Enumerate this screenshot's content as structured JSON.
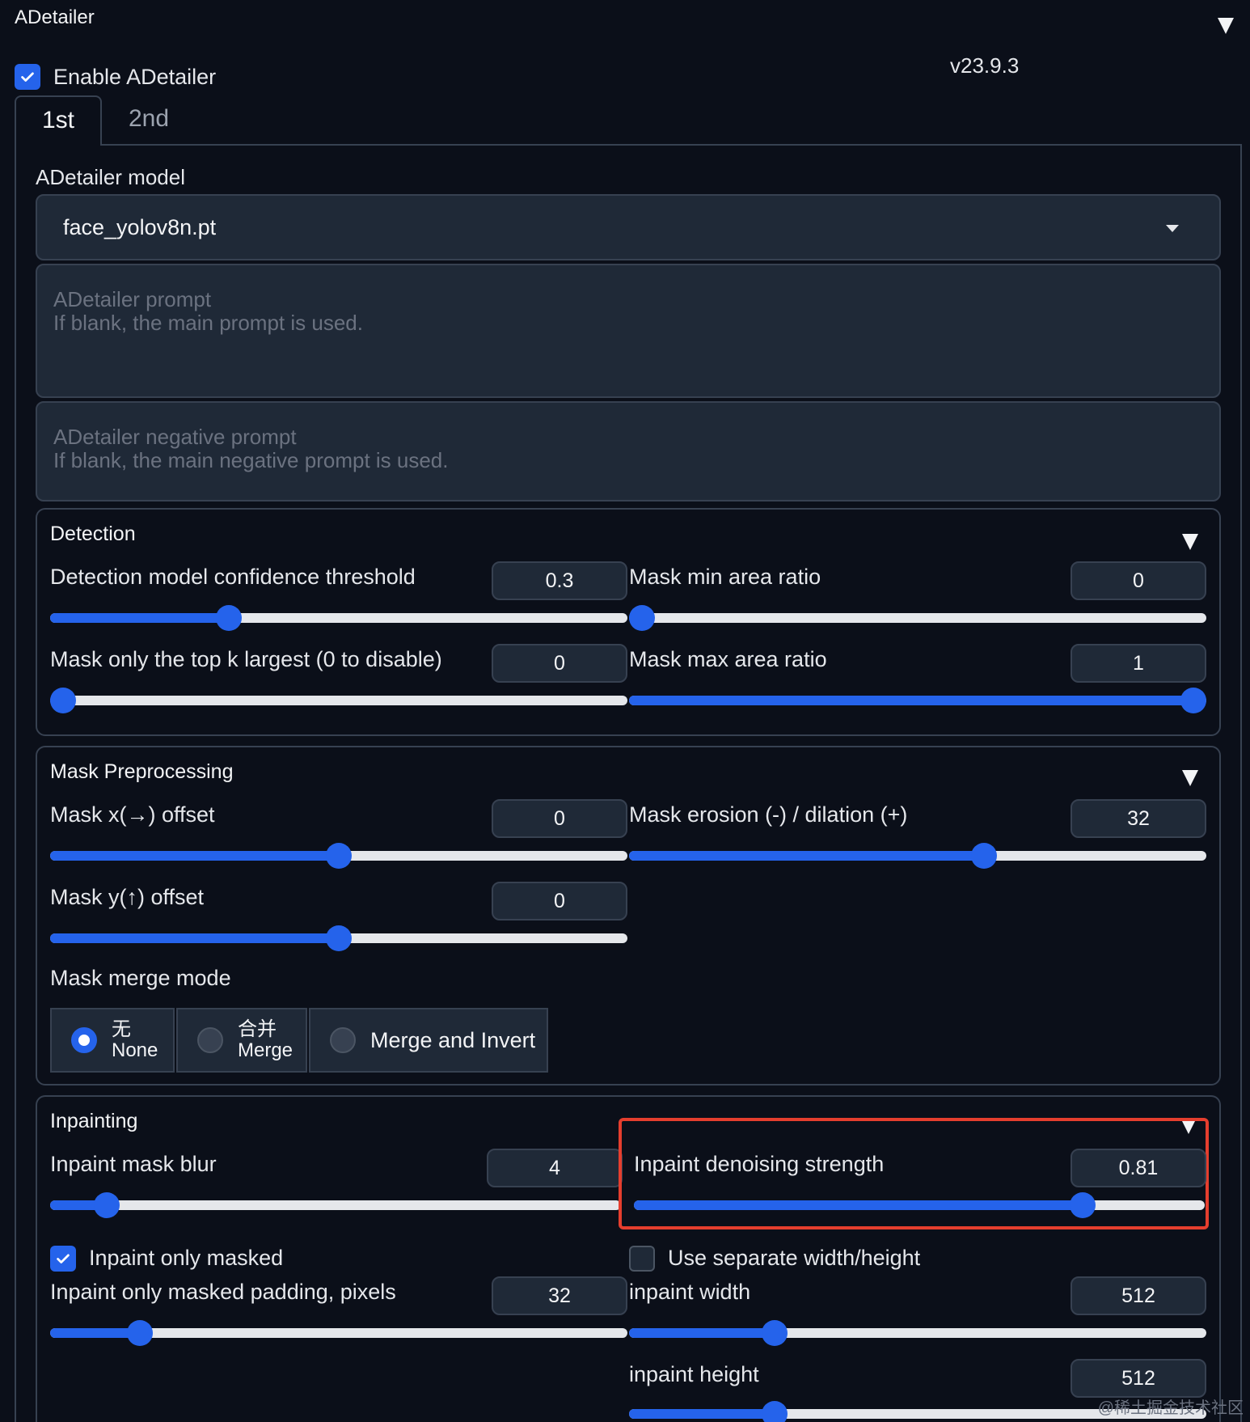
{
  "header": {
    "title": "ADetailer",
    "version": "v23.9.3"
  },
  "enable": {
    "label": "Enable ADetailer",
    "checked": true
  },
  "tabs": [
    {
      "label": "1st",
      "active": true
    },
    {
      "label": "2nd",
      "active": false
    }
  ],
  "model": {
    "label": "ADetailer model",
    "value": "face_yolov8n.pt"
  },
  "prompt": {
    "placeholder": "ADetailer prompt\nIf blank, the main prompt is used."
  },
  "negative_prompt": {
    "placeholder": "ADetailer negative prompt\nIf blank, the main negative prompt is used."
  },
  "detection": {
    "title": "Detection",
    "confidence": {
      "label": "Detection model confidence threshold",
      "value": "0.3",
      "fraction": 0.3
    },
    "min_area": {
      "label": "Mask min area ratio",
      "value": "0",
      "fraction": 0.0
    },
    "top_k": {
      "label": "Mask only the top k largest (0 to disable)",
      "value": "0",
      "fraction": 0.0
    },
    "max_area": {
      "label": "Mask max area ratio",
      "value": "1",
      "fraction": 1.0
    }
  },
  "mask_preprocessing": {
    "title": "Mask Preprocessing",
    "x_offset": {
      "label": "Mask x(→) offset",
      "value": "0",
      "fraction": 0.5
    },
    "erosion": {
      "label": "Mask erosion (-) / dilation (+)",
      "value": "32",
      "fraction": 0.62
    },
    "y_offset": {
      "label": "Mask y(↑) offset",
      "value": "0",
      "fraction": 0.5
    },
    "merge_mode": {
      "label": "Mask merge mode",
      "options": [
        {
          "zh": "无",
          "en": "None",
          "selected": true
        },
        {
          "zh": "合并",
          "en": "Merge",
          "selected": false
        },
        {
          "zh": "",
          "en": "Merge and Invert",
          "selected": false
        }
      ]
    }
  },
  "inpainting": {
    "title": "Inpainting",
    "mask_blur": {
      "label": "Inpaint mask blur",
      "value": "4",
      "fraction": 0.08
    },
    "denoising": {
      "label": "Inpaint denoising strength",
      "value": "0.81",
      "fraction": 0.8
    },
    "only_masked": {
      "label": "Inpaint only masked",
      "checked": true
    },
    "separate_wh": {
      "label": "Use separate width/height",
      "checked": false
    },
    "padding": {
      "label": "Inpaint only masked padding, pixels",
      "value": "32",
      "fraction": 0.14
    },
    "width": {
      "label": "inpaint width",
      "value": "512",
      "fraction": 0.24
    },
    "height": {
      "label": "inpaint height",
      "value": "512",
      "fraction": 0.24
    }
  },
  "watermark": "@稀土掘金技术社区",
  "colors": {
    "accent": "#2563eb",
    "background": "#0b0f19",
    "panel": "#1f2937",
    "highlight": "#e53e2e"
  },
  "icons": {
    "collapse": "triangle-down-icon",
    "check": "check-icon",
    "dropdown": "caret-down-icon"
  }
}
